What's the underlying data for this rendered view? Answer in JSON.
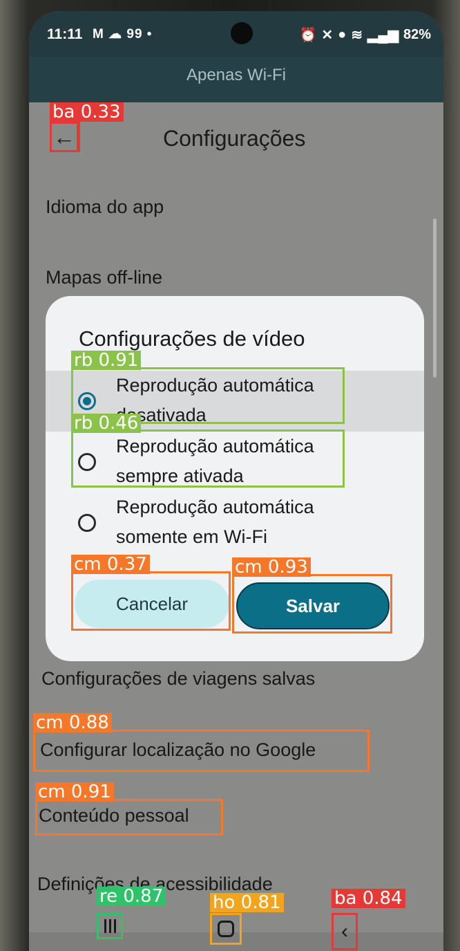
{
  "status": {
    "time": "11:11",
    "icons_left": "M ☁ 99 •",
    "battery": "82%"
  },
  "network_bar": {
    "text": "Apenas Wi-Fi"
  },
  "header": {
    "back_icon": "←",
    "title": "Configurações"
  },
  "settings_rows": [
    {
      "label": "Idioma do app"
    },
    {
      "label": "Mapas off-line"
    },
    {
      "label": "Configurações de viagens salvas"
    },
    {
      "label": "Configurar localização no Google"
    },
    {
      "label": "Conteúdo pessoal"
    },
    {
      "label": "Definições de acessibilidade"
    }
  ],
  "dialog": {
    "title": "Configurações de vídeo",
    "options": [
      {
        "line1": "Reprodução automática",
        "line2": "desativada",
        "selected": true
      },
      {
        "line1": "Reprodução automática",
        "line2": "sempre ativada",
        "selected": false
      },
      {
        "line1": "Reprodução automática",
        "line2": "somente em Wi-Fi",
        "selected": false
      }
    ],
    "cancel_label": "Cancelar",
    "save_label": "Salvar"
  },
  "annotations": [
    {
      "label": "ba 0.33",
      "color": "#e53935"
    },
    {
      "label": "rb 0.91",
      "color": "#8bc34a"
    },
    {
      "label": "rb 0.46",
      "color": "#8bc34a"
    },
    {
      "label": "cm 0.37",
      "color": "#f4772a"
    },
    {
      "label": "cm 0.93",
      "color": "#f4772a"
    },
    {
      "label": "cm 0.88",
      "color": "#f4772a"
    },
    {
      "label": "cm 0.91",
      "color": "#f4772a"
    },
    {
      "label": "re 0.87",
      "color": "#2fc26a"
    },
    {
      "label": "ho 0.81",
      "color": "#f2a51c"
    },
    {
      "label": "ba 0.84",
      "color": "#e53935"
    }
  ]
}
